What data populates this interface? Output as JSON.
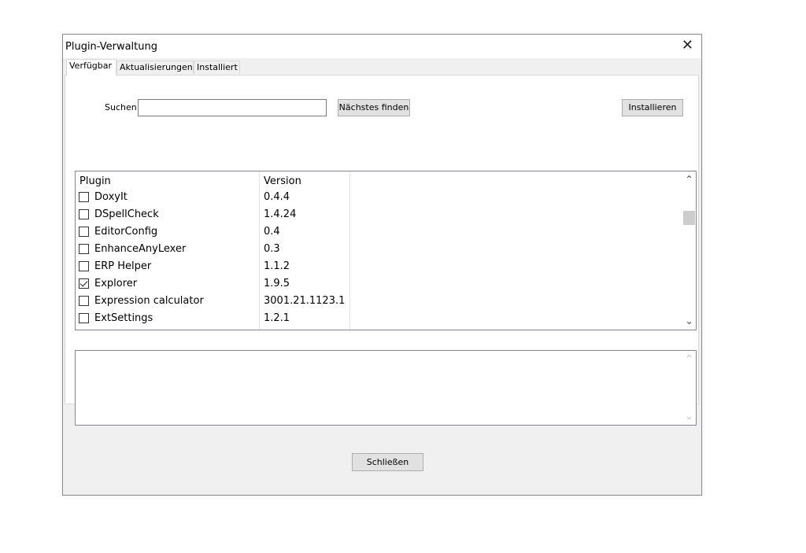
{
  "window": {
    "title": "Plugin-Verwaltung",
    "close_glyph": "✕"
  },
  "tabs": [
    {
      "label": "Verfügbar",
      "active": true
    },
    {
      "label": "Aktualisierungen",
      "active": false
    },
    {
      "label": "Installiert",
      "active": false
    }
  ],
  "search": {
    "label": "Suchen:",
    "value": "",
    "find_next_label": "Nächstes finden"
  },
  "install_label": "Installieren",
  "plugin_list": {
    "columns": [
      "Plugin",
      "Version"
    ],
    "rows": [
      {
        "name": "DoxyIt",
        "version": "0.4.4",
        "checked": false
      },
      {
        "name": "DSpellCheck",
        "version": "1.4.24",
        "checked": false
      },
      {
        "name": "EditorConfig",
        "version": "0.4",
        "checked": false
      },
      {
        "name": "EnhanceAnyLexer",
        "version": "0.3",
        "checked": false
      },
      {
        "name": "ERP Helper",
        "version": "1.1.2",
        "checked": false
      },
      {
        "name": "Explorer",
        "version": "1.9.5",
        "checked": true
      },
      {
        "name": "Expression calculator",
        "version": "3001.21.1123.1",
        "checked": false
      },
      {
        "name": "ExtSettings",
        "version": "1.2.1",
        "checked": false
      }
    ],
    "scroll_up_glyph": "⌃",
    "scroll_down_glyph": "⌄"
  },
  "description": {
    "text": ""
  },
  "close_button_label": "Schließen"
}
